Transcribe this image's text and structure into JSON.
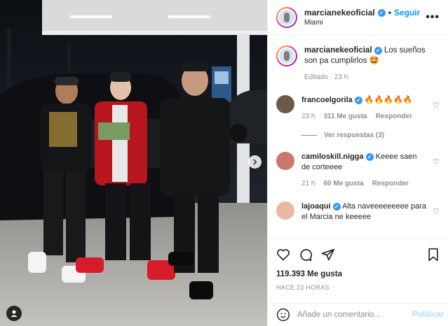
{
  "post": {
    "author": "marcianekeoficial",
    "follow_label": "Seguir",
    "separator": "•",
    "location": "Miami",
    "more_label": "•••",
    "caption_text": "Los sueños son pa cumplirlos 🤩",
    "caption_meta": "Editado · 23 h",
    "likes": "119.393 Me gusta",
    "time_ago": "HACE 23 HORAS"
  },
  "comments": [
    {
      "user": "francoelgorila",
      "text": "🔥🔥🔥🔥🔥",
      "time": "23 h",
      "likes": "311 Me gusta",
      "reply": "Responder",
      "view_replies": "Ver respuestas (3)",
      "avatar_color": "#6b5a4a"
    },
    {
      "user": "camiloskill.nigga",
      "text": "Keeee saen de corteeee",
      "time": "21 h",
      "likes": "60 Me gusta",
      "reply": "Responder",
      "avatar_color": "#c9786a"
    },
    {
      "user": "lajoaqui",
      "text": "Alta naveeeeeeeee para el Marcia ne keeeee",
      "avatar_color": "#e8b9a0"
    }
  ],
  "composer": {
    "placeholder": "Añade un comentario...",
    "post_label": "Publicar"
  },
  "icons": {
    "like": "heart-icon",
    "comment": "comment-icon",
    "share": "share-icon",
    "save": "bookmark-icon",
    "emoji": "emoji-icon",
    "next": "chevron-right-icon",
    "tags": "user-tag-icon",
    "verified": "verified-badge-icon"
  },
  "colors": {
    "accent": "#0095f6",
    "verified": "#3897f0",
    "muted": "#8e8e8e"
  }
}
